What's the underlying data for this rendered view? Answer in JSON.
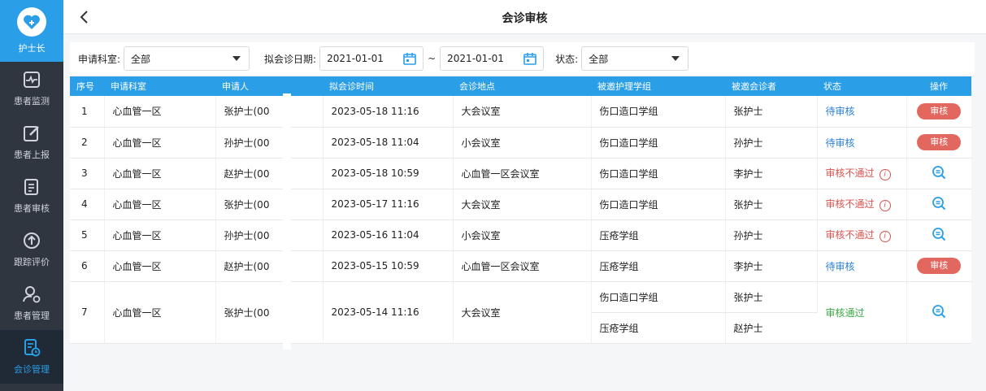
{
  "sidebar": {
    "brand_label": "护士长",
    "items": [
      {
        "label": "患者监测",
        "icon": "monitor-icon"
      },
      {
        "label": "患者上报",
        "icon": "edit-icon"
      },
      {
        "label": "患者审核",
        "icon": "review-doc-icon"
      },
      {
        "label": "跟踪评价",
        "icon": "track-icon"
      },
      {
        "label": "患者管理",
        "icon": "user-manage-icon"
      },
      {
        "label": "会诊管理",
        "icon": "consult-doc-icon",
        "active": true
      }
    ]
  },
  "header": {
    "title": "会诊审核"
  },
  "filters": {
    "dept_label": "申请科室:",
    "dept_value": "全部",
    "date_label": "拟会诊日期:",
    "date_from": "2021-01-01",
    "date_to": "2021-01-01",
    "tilde": "~",
    "status_label": "状态:",
    "status_value": "全部"
  },
  "table": {
    "headers": [
      "序号",
      "申请科室",
      "申请人",
      "拟会诊时间",
      "会诊地点",
      "被邀护理学组",
      "被邀会诊者",
      "状态",
      "操作"
    ],
    "rows": [
      {
        "seq": "1",
        "dept": "心血管一区",
        "applicant": "张护士(00",
        "time": "2023-05-18 11:16",
        "place": "大会议室",
        "group": "伤口造口学组",
        "invitee": "张护士",
        "status": "待审核",
        "status_type": "pending",
        "action": "审核"
      },
      {
        "seq": "2",
        "dept": "心血管一区",
        "applicant": "孙护士(00",
        "time": "2023-05-18 11:04",
        "place": "小会议室",
        "group": "伤口造口学组",
        "invitee": "孙护士",
        "status": "待审核",
        "status_type": "pending",
        "action": "审核"
      },
      {
        "seq": "3",
        "dept": "心血管一区",
        "applicant": "赵护士(00",
        "time": "2023-05-18 10:59",
        "place": "心血管一区会议室",
        "group": "伤口造口学组",
        "invitee": "李护士",
        "status": "审核不通过",
        "status_type": "reject",
        "action": "view"
      },
      {
        "seq": "4",
        "dept": "心血管一区",
        "applicant": "张护士(00",
        "time": "2023-05-17 11:16",
        "place": "大会议室",
        "group": "伤口造口学组",
        "invitee": "张护士",
        "status": "审核不通过",
        "status_type": "reject",
        "action": "view"
      },
      {
        "seq": "5",
        "dept": "心血管一区",
        "applicant": "孙护士(00",
        "time": "2023-05-16 11:04",
        "place": "小会议室",
        "group": "压疮学组",
        "invitee": "孙护士",
        "status": "审核不通过",
        "status_type": "reject",
        "action": "view"
      },
      {
        "seq": "6",
        "dept": "心血管一区",
        "applicant": "赵护士(00",
        "time": "2023-05-15 10:59",
        "place": "心血管一区会议室",
        "group": "压疮学组",
        "invitee": "李护士",
        "status": "待审核",
        "status_type": "pending",
        "action": "审核"
      },
      {
        "seq": "7",
        "dept": "心血管一区",
        "applicant": "张护士(00",
        "time": "2023-05-14 11:16",
        "place": "大会议室",
        "group": "伤口造口学组",
        "invitee": "张护士",
        "group2": "压疮学组",
        "invitee2": "赵护士",
        "status": "审核通过",
        "status_type": "pass",
        "action": "view"
      }
    ]
  },
  "colors": {
    "primary": "#2b9ee8",
    "sidebar": "#2f3640",
    "danger": "#e2685f",
    "pass": "#3aa845"
  }
}
